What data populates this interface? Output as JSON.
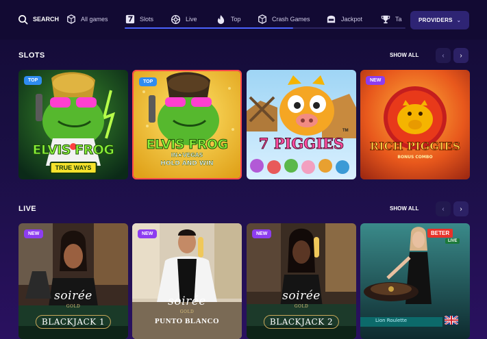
{
  "nav": {
    "search_label": "SEARCH",
    "items": [
      {
        "label": "All games",
        "icon": "dice-icon"
      },
      {
        "label": "Slots",
        "icon": "seven-icon"
      },
      {
        "label": "Live",
        "icon": "live-icon"
      },
      {
        "label": "Top",
        "icon": "flame-icon"
      },
      {
        "label": "Crash Games",
        "icon": "dice-icon"
      },
      {
        "label": "Jackpot",
        "icon": "jackpot-icon"
      },
      {
        "label": "Ta",
        "icon": "trophy-icon"
      }
    ],
    "providers_label": "PROVIDERS"
  },
  "slots": {
    "title": "SLOTS",
    "show_all": "SHOW ALL",
    "games": [
      {
        "badge": "TOP",
        "title": "ELVIS FROG",
        "subtitle": "TRUE WAYS"
      },
      {
        "badge": "TOP",
        "title": "ELVIS FROG",
        "line2": "IN★VEGAS",
        "line3": "HOLD AND WIN"
      },
      {
        "badge": "",
        "title": "7 PIGGIES",
        "tm": "TM"
      },
      {
        "badge": "NEW",
        "title": "RICH PIGGIES",
        "subtitle": "BONUS COMBO"
      }
    ]
  },
  "live": {
    "title": "LIVE",
    "show_all": "SHOW ALL",
    "games": [
      {
        "badge": "NEW",
        "brand": "soirée",
        "tier": "GOLD",
        "title": "BLACKJACK 1"
      },
      {
        "badge": "NEW",
        "brand": "soirée",
        "tier": "GOLD",
        "title": "PUNTO BLANCO"
      },
      {
        "badge": "NEW",
        "brand": "soirée",
        "tier": "GOLD",
        "title": "BLACKJACK 2"
      },
      {
        "badge": "",
        "provider": "BETER",
        "status": "LIVE",
        "title": "Lion Roulette"
      }
    ]
  },
  "colors": {
    "accent": "#4b63ff",
    "badge_top": "#2f8cf0",
    "badge_new": "#8d3df0",
    "background": "#1a0f44"
  }
}
